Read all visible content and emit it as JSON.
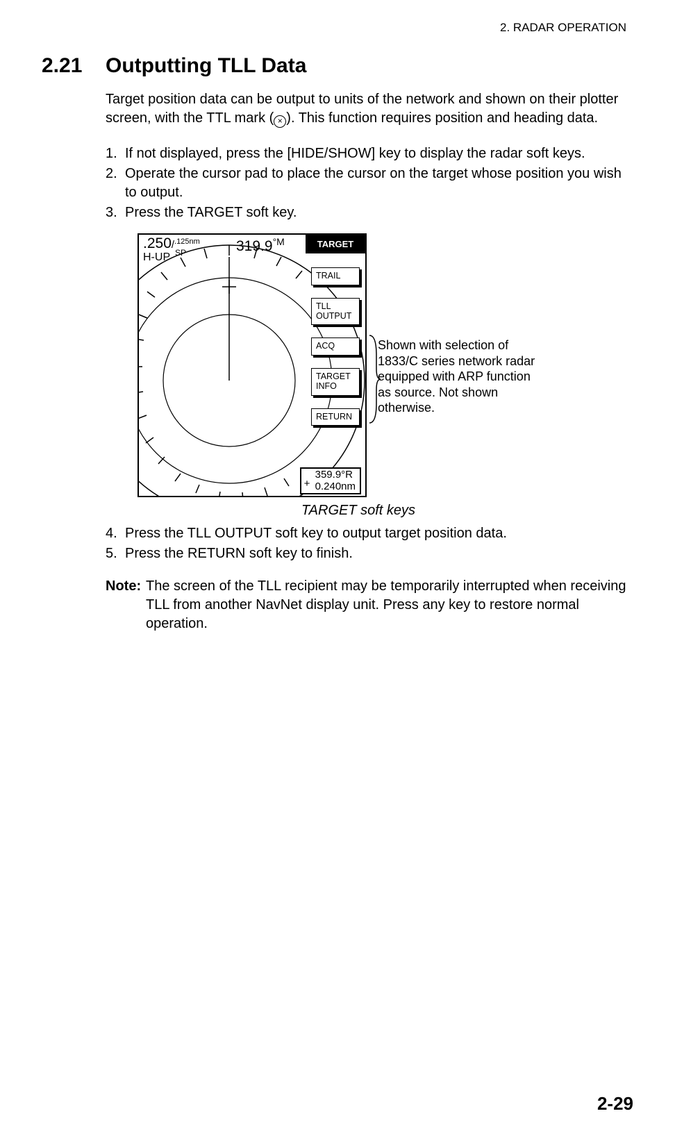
{
  "header": {
    "running": "2. RADAR OPERATION"
  },
  "section": {
    "number": "2.21",
    "title": "Outputting TLL Data"
  },
  "intro": "Target position data can be output to units of the network and shown on their plotter screen, with the TTL mark (⊗). This function requires position and heading data.",
  "steps_a": [
    {
      "n": "1.",
      "t": "If not displayed, press the [HIDE/SHOW] key to display the radar soft keys."
    },
    {
      "n": "2.",
      "t": "Operate the cursor pad to place the cursor on the target whose position you wish to output."
    },
    {
      "n": "3.",
      "t": "Press the TARGET soft key."
    }
  ],
  "radar": {
    "range_main": ".250",
    "range_slash": "/",
    "range_sub": ".125nm",
    "sp": "SP",
    "hup": "H-UP",
    "bearing": "319.9",
    "bearing_unit": "°M",
    "sk_header": "TARGET",
    "softkeys": [
      {
        "label": "TRAIL"
      },
      {
        "label": "TLL\nOUTPUT"
      },
      {
        "label": "ACQ"
      },
      {
        "label": "TARGET\n INFO"
      },
      {
        "label": "RETURN"
      }
    ],
    "cursor": {
      "brg": "359.9°R",
      "rng": "0.240nm"
    }
  },
  "annotation": "Shown with selection of 1833/C series network radar equipped with ARP function as source. Not shown otherwise.",
  "caption": "TARGET soft keys",
  "steps_b": [
    {
      "n": "4.",
      "t": "Press the TLL OUTPUT soft key to output target position data."
    },
    {
      "n": "5.",
      "t": "Press the RETURN soft key to finish."
    }
  ],
  "note": {
    "label": "Note:",
    "text": "The screen of the TLL recipient may be temporarily interrupted when receiving TLL from another NavNet display unit. Press any key to restore normal operation."
  },
  "page": "2-29"
}
